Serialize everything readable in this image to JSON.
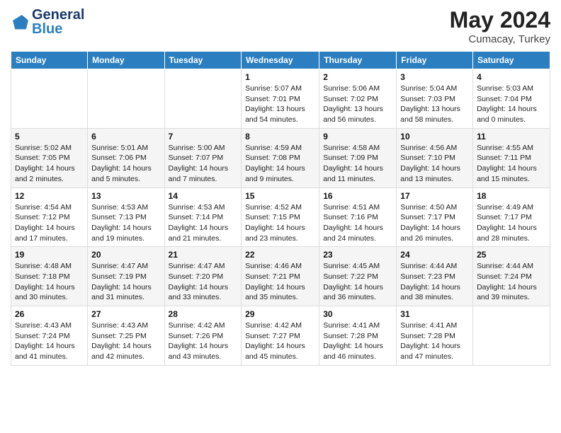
{
  "header": {
    "logo_line1": "General",
    "logo_line2": "Blue",
    "month": "May 2024",
    "location": "Cumacay, Turkey"
  },
  "weekdays": [
    "Sunday",
    "Monday",
    "Tuesday",
    "Wednesday",
    "Thursday",
    "Friday",
    "Saturday"
  ],
  "weeks": [
    [
      {
        "day": "",
        "info": ""
      },
      {
        "day": "",
        "info": ""
      },
      {
        "day": "",
        "info": ""
      },
      {
        "day": "1",
        "info": "Sunrise: 5:07 AM\nSunset: 7:01 PM\nDaylight: 13 hours\nand 54 minutes."
      },
      {
        "day": "2",
        "info": "Sunrise: 5:06 AM\nSunset: 7:02 PM\nDaylight: 13 hours\nand 56 minutes."
      },
      {
        "day": "3",
        "info": "Sunrise: 5:04 AM\nSunset: 7:03 PM\nDaylight: 13 hours\nand 58 minutes."
      },
      {
        "day": "4",
        "info": "Sunrise: 5:03 AM\nSunset: 7:04 PM\nDaylight: 14 hours\nand 0 minutes."
      }
    ],
    [
      {
        "day": "5",
        "info": "Sunrise: 5:02 AM\nSunset: 7:05 PM\nDaylight: 14 hours\nand 2 minutes."
      },
      {
        "day": "6",
        "info": "Sunrise: 5:01 AM\nSunset: 7:06 PM\nDaylight: 14 hours\nand 5 minutes."
      },
      {
        "day": "7",
        "info": "Sunrise: 5:00 AM\nSunset: 7:07 PM\nDaylight: 14 hours\nand 7 minutes."
      },
      {
        "day": "8",
        "info": "Sunrise: 4:59 AM\nSunset: 7:08 PM\nDaylight: 14 hours\nand 9 minutes."
      },
      {
        "day": "9",
        "info": "Sunrise: 4:58 AM\nSunset: 7:09 PM\nDaylight: 14 hours\nand 11 minutes."
      },
      {
        "day": "10",
        "info": "Sunrise: 4:56 AM\nSunset: 7:10 PM\nDaylight: 14 hours\nand 13 minutes."
      },
      {
        "day": "11",
        "info": "Sunrise: 4:55 AM\nSunset: 7:11 PM\nDaylight: 14 hours\nand 15 minutes."
      }
    ],
    [
      {
        "day": "12",
        "info": "Sunrise: 4:54 AM\nSunset: 7:12 PM\nDaylight: 14 hours\nand 17 minutes."
      },
      {
        "day": "13",
        "info": "Sunrise: 4:53 AM\nSunset: 7:13 PM\nDaylight: 14 hours\nand 19 minutes."
      },
      {
        "day": "14",
        "info": "Sunrise: 4:53 AM\nSunset: 7:14 PM\nDaylight: 14 hours\nand 21 minutes."
      },
      {
        "day": "15",
        "info": "Sunrise: 4:52 AM\nSunset: 7:15 PM\nDaylight: 14 hours\nand 23 minutes."
      },
      {
        "day": "16",
        "info": "Sunrise: 4:51 AM\nSunset: 7:16 PM\nDaylight: 14 hours\nand 24 minutes."
      },
      {
        "day": "17",
        "info": "Sunrise: 4:50 AM\nSunset: 7:17 PM\nDaylight: 14 hours\nand 26 minutes."
      },
      {
        "day": "18",
        "info": "Sunrise: 4:49 AM\nSunset: 7:17 PM\nDaylight: 14 hours\nand 28 minutes."
      }
    ],
    [
      {
        "day": "19",
        "info": "Sunrise: 4:48 AM\nSunset: 7:18 PM\nDaylight: 14 hours\nand 30 minutes."
      },
      {
        "day": "20",
        "info": "Sunrise: 4:47 AM\nSunset: 7:19 PM\nDaylight: 14 hours\nand 31 minutes."
      },
      {
        "day": "21",
        "info": "Sunrise: 4:47 AM\nSunset: 7:20 PM\nDaylight: 14 hours\nand 33 minutes."
      },
      {
        "day": "22",
        "info": "Sunrise: 4:46 AM\nSunset: 7:21 PM\nDaylight: 14 hours\nand 35 minutes."
      },
      {
        "day": "23",
        "info": "Sunrise: 4:45 AM\nSunset: 7:22 PM\nDaylight: 14 hours\nand 36 minutes."
      },
      {
        "day": "24",
        "info": "Sunrise: 4:44 AM\nSunset: 7:23 PM\nDaylight: 14 hours\nand 38 minutes."
      },
      {
        "day": "25",
        "info": "Sunrise: 4:44 AM\nSunset: 7:24 PM\nDaylight: 14 hours\nand 39 minutes."
      }
    ],
    [
      {
        "day": "26",
        "info": "Sunrise: 4:43 AM\nSunset: 7:24 PM\nDaylight: 14 hours\nand 41 minutes."
      },
      {
        "day": "27",
        "info": "Sunrise: 4:43 AM\nSunset: 7:25 PM\nDaylight: 14 hours\nand 42 minutes."
      },
      {
        "day": "28",
        "info": "Sunrise: 4:42 AM\nSunset: 7:26 PM\nDaylight: 14 hours\nand 43 minutes."
      },
      {
        "day": "29",
        "info": "Sunrise: 4:42 AM\nSunset: 7:27 PM\nDaylight: 14 hours\nand 45 minutes."
      },
      {
        "day": "30",
        "info": "Sunrise: 4:41 AM\nSunset: 7:28 PM\nDaylight: 14 hours\nand 46 minutes."
      },
      {
        "day": "31",
        "info": "Sunrise: 4:41 AM\nSunset: 7:28 PM\nDaylight: 14 hours\nand 47 minutes."
      },
      {
        "day": "",
        "info": ""
      }
    ]
  ]
}
